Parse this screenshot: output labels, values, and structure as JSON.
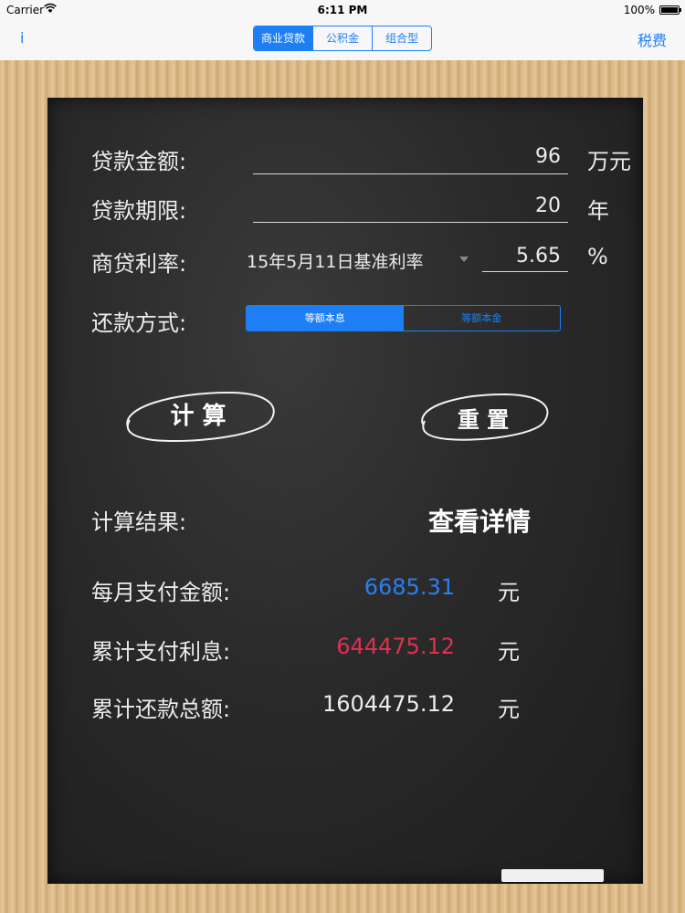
{
  "status_bar": {
    "carrier": "Carrier",
    "time": "6:11 PM",
    "battery": "100%"
  },
  "nav": {
    "info": "i",
    "tax": "税费",
    "segments": [
      "商业贷款",
      "公积金",
      "组合型"
    ],
    "selected_segment": 0
  },
  "form": {
    "amount": {
      "label": "贷款金额:",
      "value": "96",
      "unit": "万元"
    },
    "term": {
      "label": "贷款期限:",
      "value": "20",
      "unit": "年"
    },
    "rate": {
      "label": "商贷利率:",
      "picker": "15年5月11日基准利率",
      "value": "5.65",
      "unit": "%"
    },
    "method": {
      "label": "还款方式:",
      "options": [
        "等额本息",
        "等额本金"
      ],
      "selected": 0
    }
  },
  "buttons": {
    "calculate": "计 算",
    "reset": "重 置"
  },
  "result": {
    "label": "计算结果:",
    "detail_link": "查看详情",
    "monthly": {
      "label": "每月支付金额:",
      "value": "6685.31",
      "unit": "元",
      "color": "#2b7ff0"
    },
    "interest": {
      "label": "累计支付利息:",
      "value": "644475.12",
      "unit": "元",
      "color": "#e0304e"
    },
    "total": {
      "label": "累计还款总额:",
      "value": "1604475.12",
      "unit": "元",
      "color": "#ececec"
    }
  }
}
